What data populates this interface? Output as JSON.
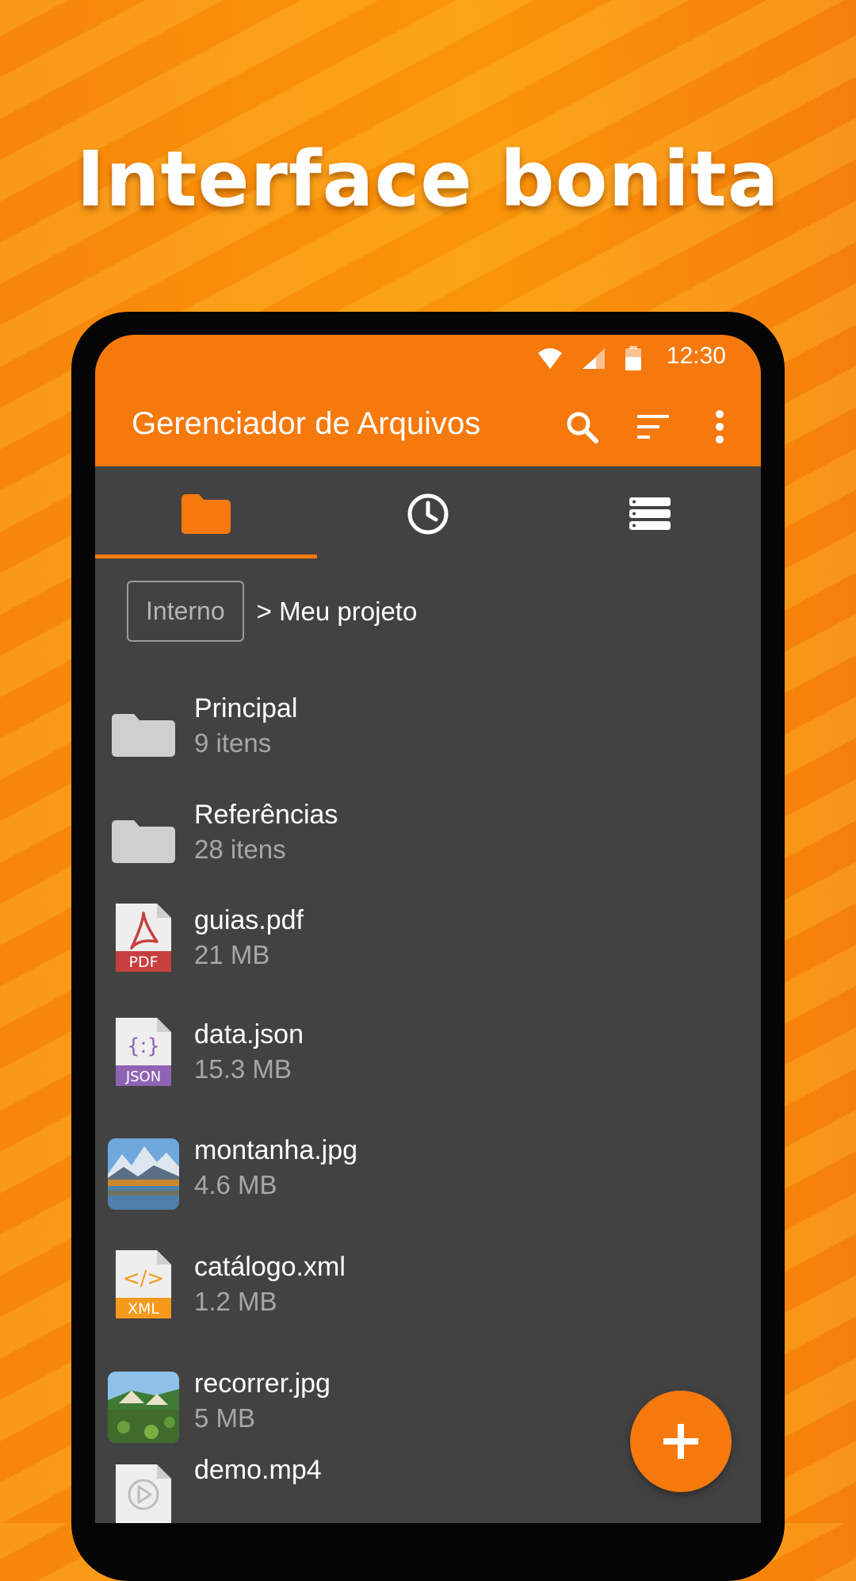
{
  "headline": "Interface bonita",
  "status": {
    "time": "12:30"
  },
  "appbar": {
    "title": "Gerenciador de Arquivos"
  },
  "icons": {
    "status": [
      "wifi-icon",
      "signal-icon",
      "battery-icon"
    ],
    "actions": [
      "search-icon",
      "sort-icon",
      "more-vert-icon"
    ],
    "tabs": [
      "folder-icon",
      "clock-icon",
      "storage-icon"
    ],
    "fab": "plus-icon"
  },
  "tabs": {
    "selected_index": 0
  },
  "breadcrumb": {
    "root": "Interno",
    "path": "> Meu projeto"
  },
  "files": [
    {
      "name": "Principal",
      "meta": "9 itens",
      "icon": "folder-icon"
    },
    {
      "name": "Referências",
      "meta": "28 itens",
      "icon": "folder-icon"
    },
    {
      "name": "guias.pdf",
      "meta": "21 MB",
      "icon": "pdf-file-icon",
      "badge": "PDF"
    },
    {
      "name": "data.json",
      "meta": "15.3 MB",
      "icon": "json-file-icon",
      "badge": "JSON",
      "glyph": "{:}"
    },
    {
      "name": "montanha.jpg",
      "meta": "4.6 MB",
      "icon": "image-thumbnail-icon"
    },
    {
      "name": "catálogo.xml",
      "meta": "1.2 MB",
      "icon": "xml-file-icon",
      "badge": "XML",
      "glyph": "</>"
    },
    {
      "name": "recorrer.jpg",
      "meta": "5 MB",
      "icon": "image-thumbnail-icon"
    },
    {
      "name": "demo.mp4",
      "meta": "",
      "icon": "video-file-icon"
    }
  ],
  "colors": {
    "accent": "#f5790d",
    "surface": "#424242",
    "pdf": "#c74040",
    "json": "#8e63b3",
    "xml": "#f59a1c"
  }
}
